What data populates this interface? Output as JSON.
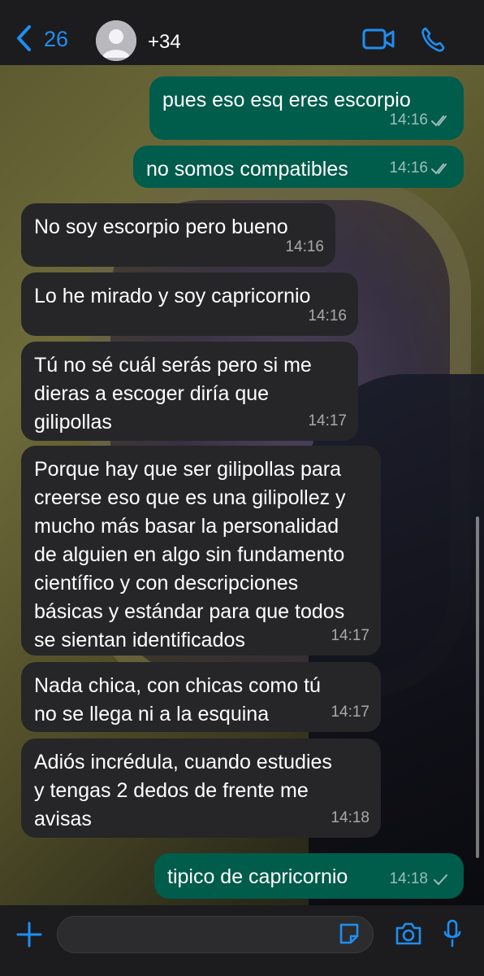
{
  "header": {
    "back_count": "26",
    "contact_name": "+34",
    "icons": [
      "chevron-left-icon",
      "avatar",
      "video-camera-icon",
      "phone-icon"
    ],
    "accent_color": "#1f8ef1"
  },
  "messages": [
    {
      "direction": "out",
      "text": "pues eso esq eres escorpio",
      "time": "14:16",
      "status": "read"
    },
    {
      "direction": "out",
      "text": "no somos compatibles",
      "time": "14:16",
      "status": "read"
    },
    {
      "direction": "in",
      "text": "No soy escorpio pero bueno",
      "time": "14:16"
    },
    {
      "direction": "in",
      "text": "Lo he mirado y soy capricornio",
      "time": "14:16"
    },
    {
      "direction": "in",
      "text": "Tú no sé cuál serás pero si me\ndieras a escoger diría que\ngilipollas",
      "time": "14:17"
    },
    {
      "direction": "in",
      "text": "Porque hay que ser gilipollas para\ncreerse eso que es una gilipollez y\nmucho más basar la personalidad\nde alguien en algo sin fundamento\ncientífico y con descripciones\nbásicas y estándar para que todos\nse sientan identificados",
      "time": "14:17"
    },
    {
      "direction": "in",
      "text": "Nada chica, con chicas como tú\nno se llega ni a la esquina",
      "time": "14:17"
    },
    {
      "direction": "in",
      "text": "Adiós incrédula, cuando estudies\ny tengas 2 dedos de frente me\navisas",
      "time": "14:18"
    },
    {
      "direction": "out",
      "text": "tipico de capricornio",
      "time": "14:18",
      "status": "delivered"
    }
  ],
  "input_bar": {
    "icons": [
      "plus-icon",
      "sticker-icon",
      "camera-icon",
      "microphone-icon"
    ],
    "message_value": ""
  },
  "colors": {
    "outgoing_bubble": "#005c4b",
    "incoming_bubble": "#262628"
  }
}
